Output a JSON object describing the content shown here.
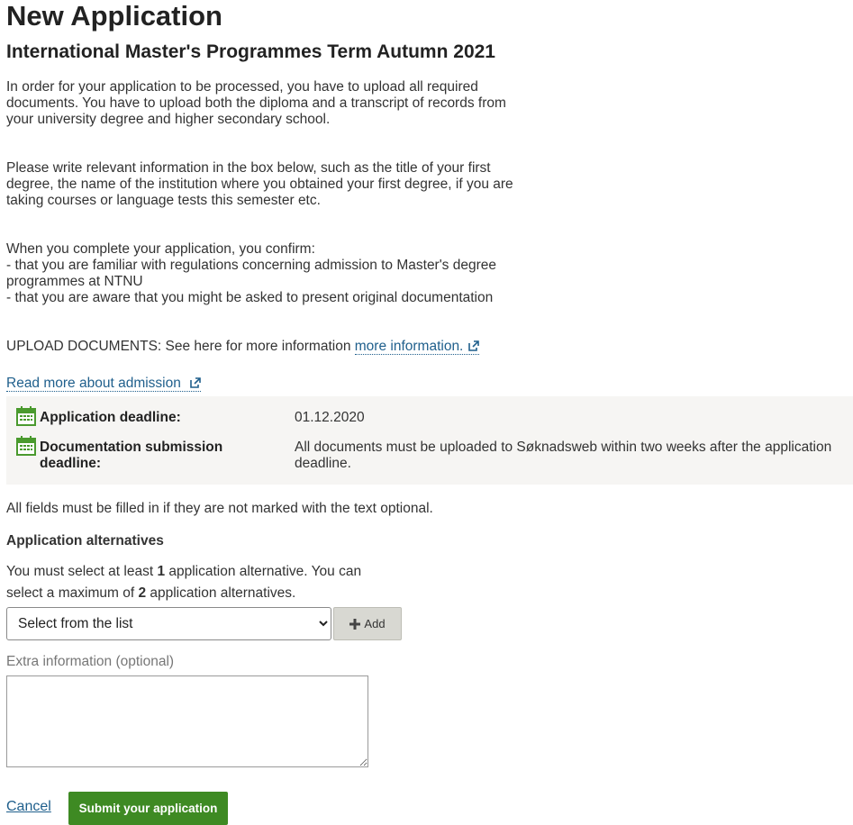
{
  "page": {
    "title": "New Application",
    "subtitle": "International Master's Programmes Term Autumn 2021"
  },
  "intro": {
    "p1": "In order for your application to be processed, you have to upload all required\ndocuments. You have to upload both the diploma and a transcript of records from\nyour university degree and higher secondary school.",
    "p2": "Please write relevant information in the box below, such as the title of your first\ndegree, the name of the institution where you obtained your first degree, if you are\ntaking courses or language tests this semester etc.",
    "p3": "When you complete your application, you confirm:\n- that you are familiar with regulations concerning admission to Master's degree\nprogrammes at NTNU\n- that you are aware that you might be asked to present original documentation",
    "upload_text": "UPLOAD DOCUMENTS: See here for more information ",
    "upload_link": "more information.",
    "read_more_link": "Read more about admission"
  },
  "deadlines": {
    "application_label": "Application deadline:",
    "application_value": "01.12.2020",
    "documentation_label": "Documentation submission\ndeadline:",
    "documentation_value": "All documents must be uploaded to Søknadsweb within two weeks after the application\ndeadline."
  },
  "form": {
    "fields_note": "All fields must be filled in if they are not marked with the text optional.",
    "alternatives_heading": "Application alternatives",
    "alt_text_1": "You must select at least ",
    "alt_min": "1",
    "alt_text_2": " application alternative. You can",
    "alt_text_3": "select a maximum of ",
    "alt_max": "2",
    "alt_text_4": " application alternatives.",
    "select_value": "Select from the list",
    "add_label": "Add",
    "extra_label": "Extra information (optional)",
    "extra_value": ""
  },
  "actions": {
    "cancel_label": "Cancel",
    "submit_label": "Submit your application"
  },
  "colors": {
    "link": "#1f5f8c",
    "submit": "#3e8a23",
    "calendar_icon": "#4a9a2e",
    "info_box": "#f6f5f3"
  },
  "icons": {
    "external": "external-link-icon",
    "calendar": "calendar-icon",
    "plus": "plus-icon"
  }
}
